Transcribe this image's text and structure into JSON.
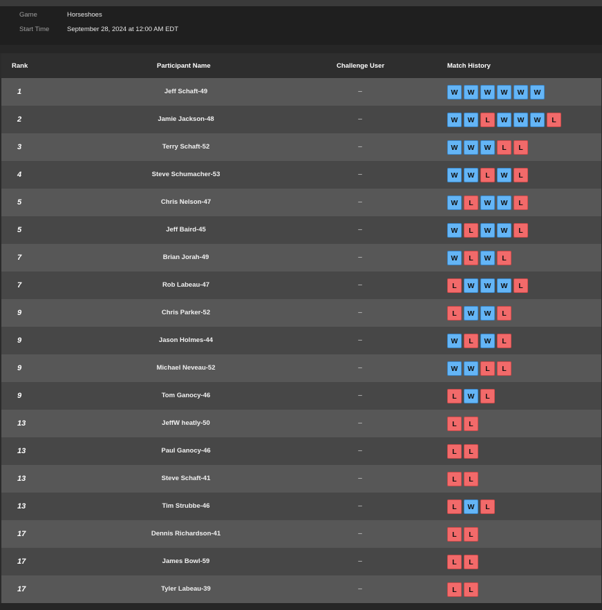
{
  "info": {
    "game_label": "Game",
    "game_value": "Horseshoes",
    "start_label": "Start Time",
    "start_value": "September 28, 2024 at 12:00 AM EDT"
  },
  "table": {
    "headers": {
      "rank": "Rank",
      "participant": "Participant Name",
      "challenge": "Challenge User",
      "history": "Match History"
    },
    "rows": [
      {
        "rank": "1",
        "name": "Jeff Schaft-49",
        "challenge": "–",
        "history": [
          "W",
          "W",
          "W",
          "W",
          "W",
          "W"
        ]
      },
      {
        "rank": "2",
        "name": "Jamie Jackson-48",
        "challenge": "–",
        "history": [
          "W",
          "W",
          "L",
          "W",
          "W",
          "W",
          "L"
        ]
      },
      {
        "rank": "3",
        "name": "Terry Schaft-52",
        "challenge": "–",
        "history": [
          "W",
          "W",
          "W",
          "L",
          "L"
        ]
      },
      {
        "rank": "4",
        "name": "Steve Schumacher-53",
        "challenge": "–",
        "history": [
          "W",
          "W",
          "L",
          "W",
          "L"
        ]
      },
      {
        "rank": "5",
        "name": "Chris Nelson-47",
        "challenge": "–",
        "history": [
          "W",
          "L",
          "W",
          "W",
          "L"
        ]
      },
      {
        "rank": "5",
        "name": "Jeff Baird-45",
        "challenge": "–",
        "history": [
          "W",
          "L",
          "W",
          "W",
          "L"
        ]
      },
      {
        "rank": "7",
        "name": "Brian Jorah-49",
        "challenge": "–",
        "history": [
          "W",
          "L",
          "W",
          "L"
        ]
      },
      {
        "rank": "7",
        "name": "Rob Labeau-47",
        "challenge": "–",
        "history": [
          "L",
          "W",
          "W",
          "W",
          "L"
        ]
      },
      {
        "rank": "9",
        "name": "Chris Parker-52",
        "challenge": "–",
        "history": [
          "L",
          "W",
          "W",
          "L"
        ]
      },
      {
        "rank": "9",
        "name": "Jason Holmes-44",
        "challenge": "–",
        "history": [
          "W",
          "L",
          "W",
          "L"
        ]
      },
      {
        "rank": "9",
        "name": "Michael Neveau-52",
        "challenge": "–",
        "history": [
          "W",
          "W",
          "L",
          "L"
        ]
      },
      {
        "rank": "9",
        "name": "Tom Ganocy-46",
        "challenge": "–",
        "history": [
          "L",
          "W",
          "L"
        ]
      },
      {
        "rank": "13",
        "name": "JeffW heatly-50",
        "challenge": "–",
        "history": [
          "L",
          "L"
        ]
      },
      {
        "rank": "13",
        "name": "Paul Ganocy-46",
        "challenge": "–",
        "history": [
          "L",
          "L"
        ]
      },
      {
        "rank": "13",
        "name": "Steve Schaft-41",
        "challenge": "–",
        "history": [
          "L",
          "L"
        ]
      },
      {
        "rank": "13",
        "name": "Tim Strubbe-46",
        "challenge": "–",
        "history": [
          "L",
          "W",
          "L"
        ]
      },
      {
        "rank": "17",
        "name": "Dennis Richardson-41",
        "challenge": "–",
        "history": [
          "L",
          "L"
        ]
      },
      {
        "rank": "17",
        "name": "James Bowl-59",
        "challenge": "–",
        "history": [
          "L",
          "L"
        ]
      },
      {
        "rank": "17",
        "name": "Tyler Labeau-39",
        "challenge": "–",
        "history": [
          "L",
          "L"
        ]
      }
    ]
  },
  "colors": {
    "win": "#64b5f6",
    "loss": "#f26a6a",
    "row_light": "#575757",
    "row_dark": "#474747"
  }
}
